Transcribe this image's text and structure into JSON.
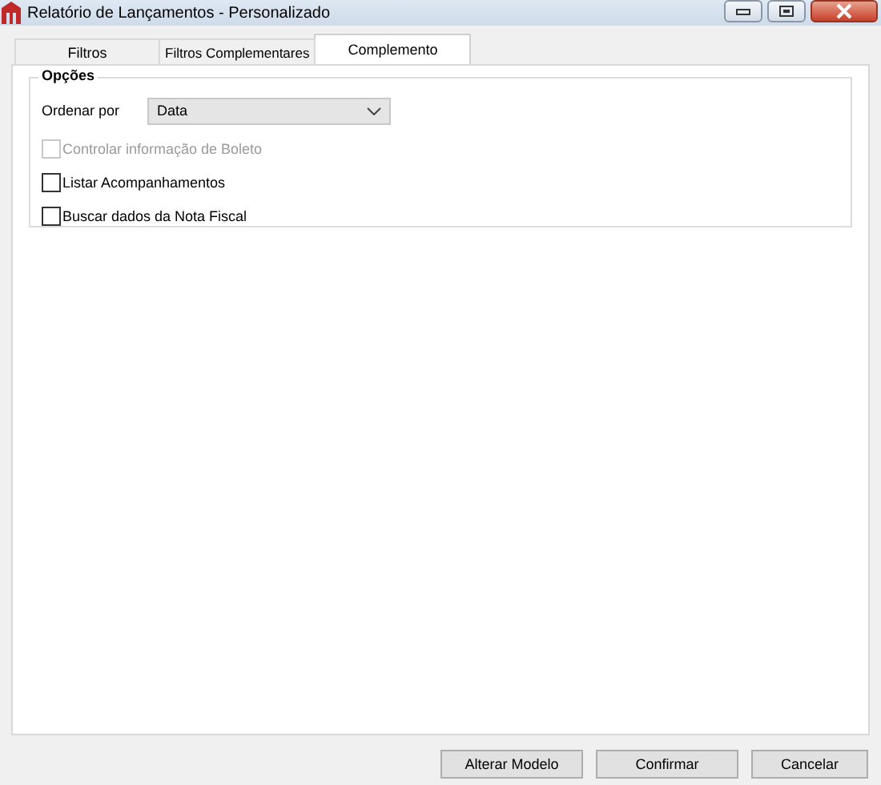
{
  "window": {
    "title": "Relatório de Lançamentos - Personalizado"
  },
  "tabs": [
    {
      "label": "Filtros",
      "selected": false
    },
    {
      "label": "Filtros Complementares",
      "selected": false
    },
    {
      "label": "Complemento",
      "selected": true
    }
  ],
  "group": {
    "title": "Opções",
    "order": {
      "label": "Ordenar por",
      "value": "Data"
    },
    "options": [
      {
        "label": "Controlar informação de Boleto",
        "checked": false,
        "disabled": true
      },
      {
        "label": "Listar Acompanhamentos",
        "checked": false,
        "disabled": false
      },
      {
        "label": "Buscar dados da Nota Fiscal",
        "checked": false,
        "disabled": false
      }
    ]
  },
  "buttons": [
    "Alterar Modelo",
    "Confirmar",
    "Cancelar"
  ]
}
